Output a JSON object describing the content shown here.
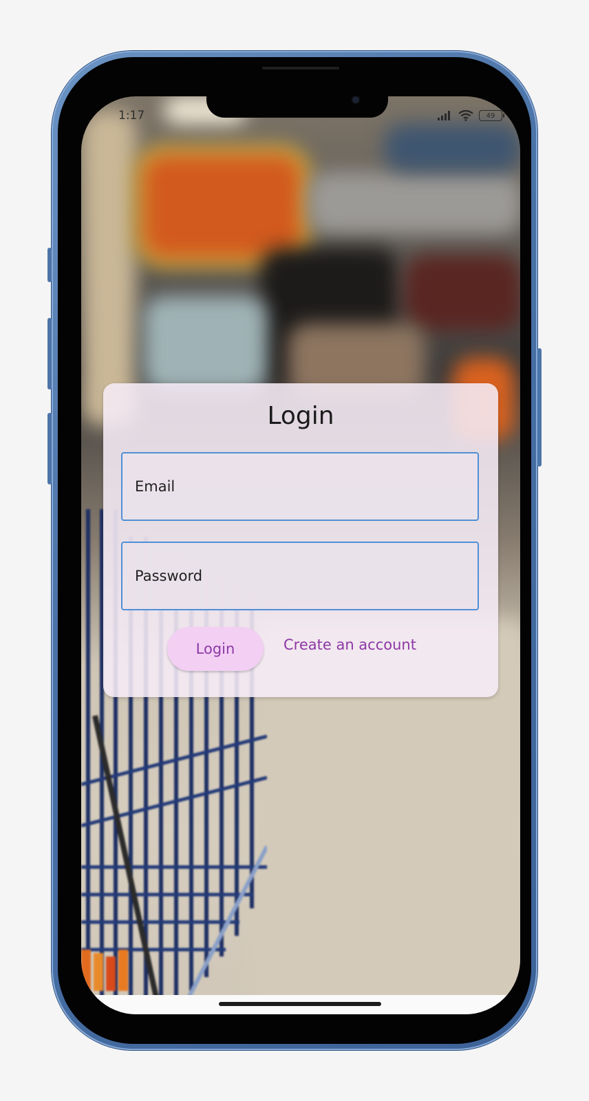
{
  "status_bar": {
    "time": "1:17",
    "battery": "49",
    "icons": [
      "signal-icon",
      "wifi-icon",
      "battery-icon"
    ]
  },
  "login_card": {
    "title": "Login",
    "email_placeholder": "Email",
    "password_placeholder": "Password",
    "login_button": "Login",
    "create_account_link": "Create an account"
  },
  "colors": {
    "accent": "#8c38a6",
    "button_bg": "#f3cff4",
    "field_border": "#4f8fd6",
    "device_frame": "#4a72a6"
  }
}
